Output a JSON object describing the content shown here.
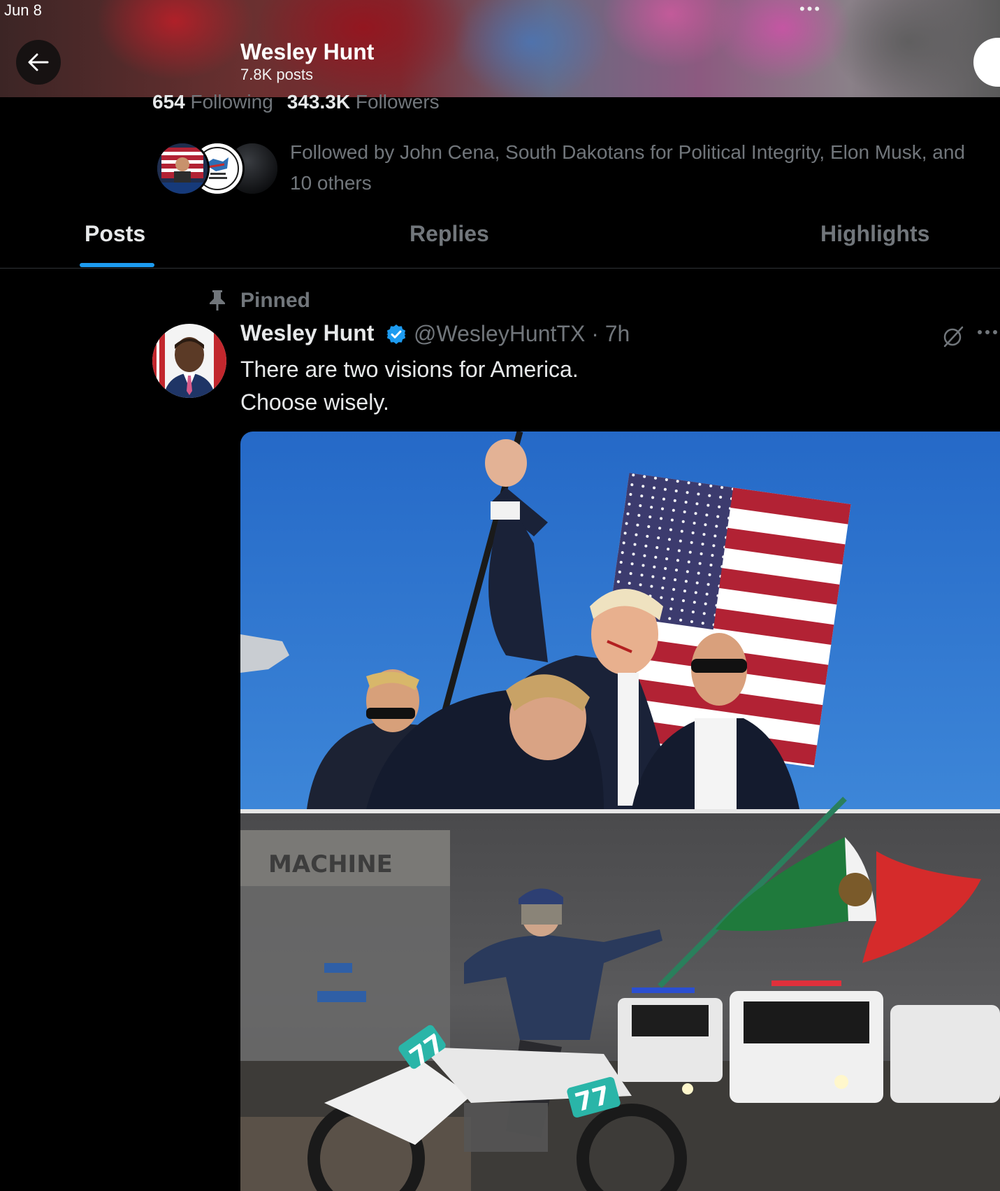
{
  "status_bar": {
    "date": "Jun 8",
    "dots": "•••"
  },
  "header": {
    "name": "Wesley Hunt",
    "posts_count": "7.8K posts"
  },
  "profile": {
    "following_count": "654",
    "following_label": "Following",
    "followers_count": "343.3K",
    "followers_label": "Followers",
    "followed_by": "Followed by John Cena, South Dakotans for Political Integrity, Elon Musk, and 10 others"
  },
  "tabs": [
    {
      "label": "Posts",
      "active": true
    },
    {
      "label": "Replies",
      "active": false
    },
    {
      "label": "Highlights",
      "active": false
    }
  ],
  "post": {
    "pinned_label": "Pinned",
    "author": "Wesley Hunt",
    "handle_time": "@WesleyHuntTX · 7h",
    "text_line1": "There are two visions for America.",
    "text_line2": "Choose wisely."
  },
  "colors": {
    "accent": "#1d9bf0",
    "background": "#000000",
    "text_primary": "#e7e9ea",
    "text_secondary": "#71767b"
  },
  "icons": [
    "back-arrow-icon",
    "pin-icon",
    "verified-badge-icon",
    "grok-icon",
    "more-icon"
  ]
}
